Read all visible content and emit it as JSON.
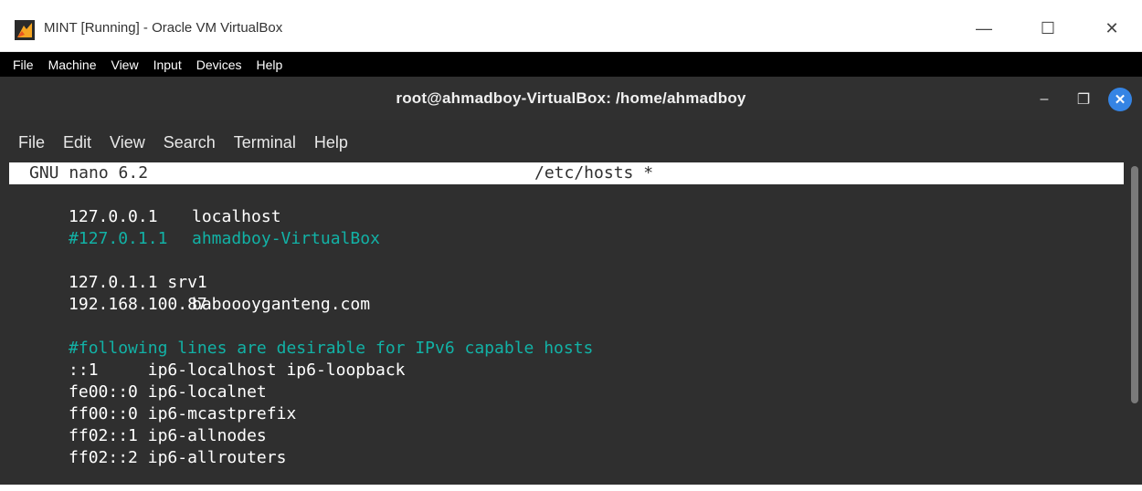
{
  "vbox": {
    "title": "MINT [Running] - Oracle VM VirtualBox",
    "controls": {
      "minimize": "—",
      "maximize": "☐",
      "close": "✕"
    },
    "menu": [
      "File",
      "Machine",
      "View",
      "Input",
      "Devices",
      "Help"
    ]
  },
  "terminal": {
    "title": "root@ahmadboy-VirtualBox: /home/ahmadboy",
    "controls": {
      "minimize": "–",
      "maximize": "❐",
      "close": "✕"
    },
    "menu": [
      "File",
      "Edit",
      "View",
      "Search",
      "Terminal",
      "Help"
    ]
  },
  "nano": {
    "version": "GNU nano 6.2",
    "filename": "/etc/hosts *",
    "lines": [
      {
        "a": "127.0.0.1",
        "b": "localhost",
        "comment": false
      },
      {
        "a": "#127.0.1.1",
        "b": "ahmadboy-VirtualBox",
        "comment": true
      },
      {
        "a": "",
        "b": "",
        "comment": false
      },
      {
        "a": "127.0.1.1 srv1",
        "b": "",
        "comment": false
      },
      {
        "a": "192.168.100.87",
        "b": "baboooyganteng.com",
        "comment": false
      },
      {
        "a": "",
        "b": "",
        "comment": false
      },
      {
        "a": "#following lines are desirable for IPv6 capable hosts",
        "b": "",
        "comment": true
      },
      {
        "a": "::1     ip6-localhost ip6-loopback",
        "b": "",
        "comment": false
      },
      {
        "a": "fe00::0 ip6-localnet",
        "b": "",
        "comment": false
      },
      {
        "a": "ff00::0 ip6-mcastprefix",
        "b": "",
        "comment": false
      },
      {
        "a": "ff02::1 ip6-allnodes",
        "b": "",
        "comment": false
      },
      {
        "a": "ff02::2 ip6-allrouters",
        "b": "",
        "comment": false
      }
    ]
  },
  "colors": {
    "terminal_bg": "#2f2f2f",
    "comment": "#12b2a6",
    "close_button": "#3584e4"
  }
}
